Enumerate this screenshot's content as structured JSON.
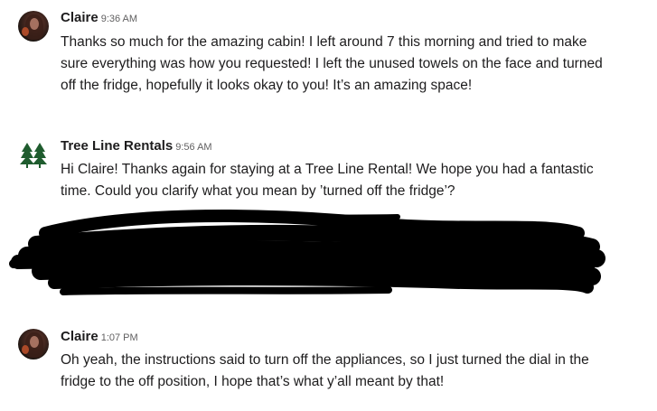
{
  "messages": [
    {
      "author": "Claire",
      "time": "9:36 AM",
      "avatar": "claire-avatar-photo",
      "text": "Thanks so much for the amazing cabin! I left around 7 this morning and tried to make sure everything was how you requested! I left the unused towels on the face and turned off the fridge, hopefully it looks okay to you! It’s an amazing space!"
    },
    {
      "author": "Tree Line Rentals",
      "time": "9:56 AM",
      "avatar": "pine-trees-logo",
      "avatar_color": "#1f5c2e",
      "text": "Hi Claire! Thanks again for staying at a Tree Line Rental! We hope you had a fantastic time. Could you clarify what you mean by ’turned off the fridge’?"
    },
    {
      "author": "Claire",
      "time": "1:07 PM",
      "avatar": "claire-avatar-photo",
      "text": "Oh yeah, the instructions said to turn off the appliances, so I just turned the dial in the fridge to the off position, I hope that’s what y’all meant by that!"
    }
  ],
  "redaction": {
    "color": "#000000"
  }
}
